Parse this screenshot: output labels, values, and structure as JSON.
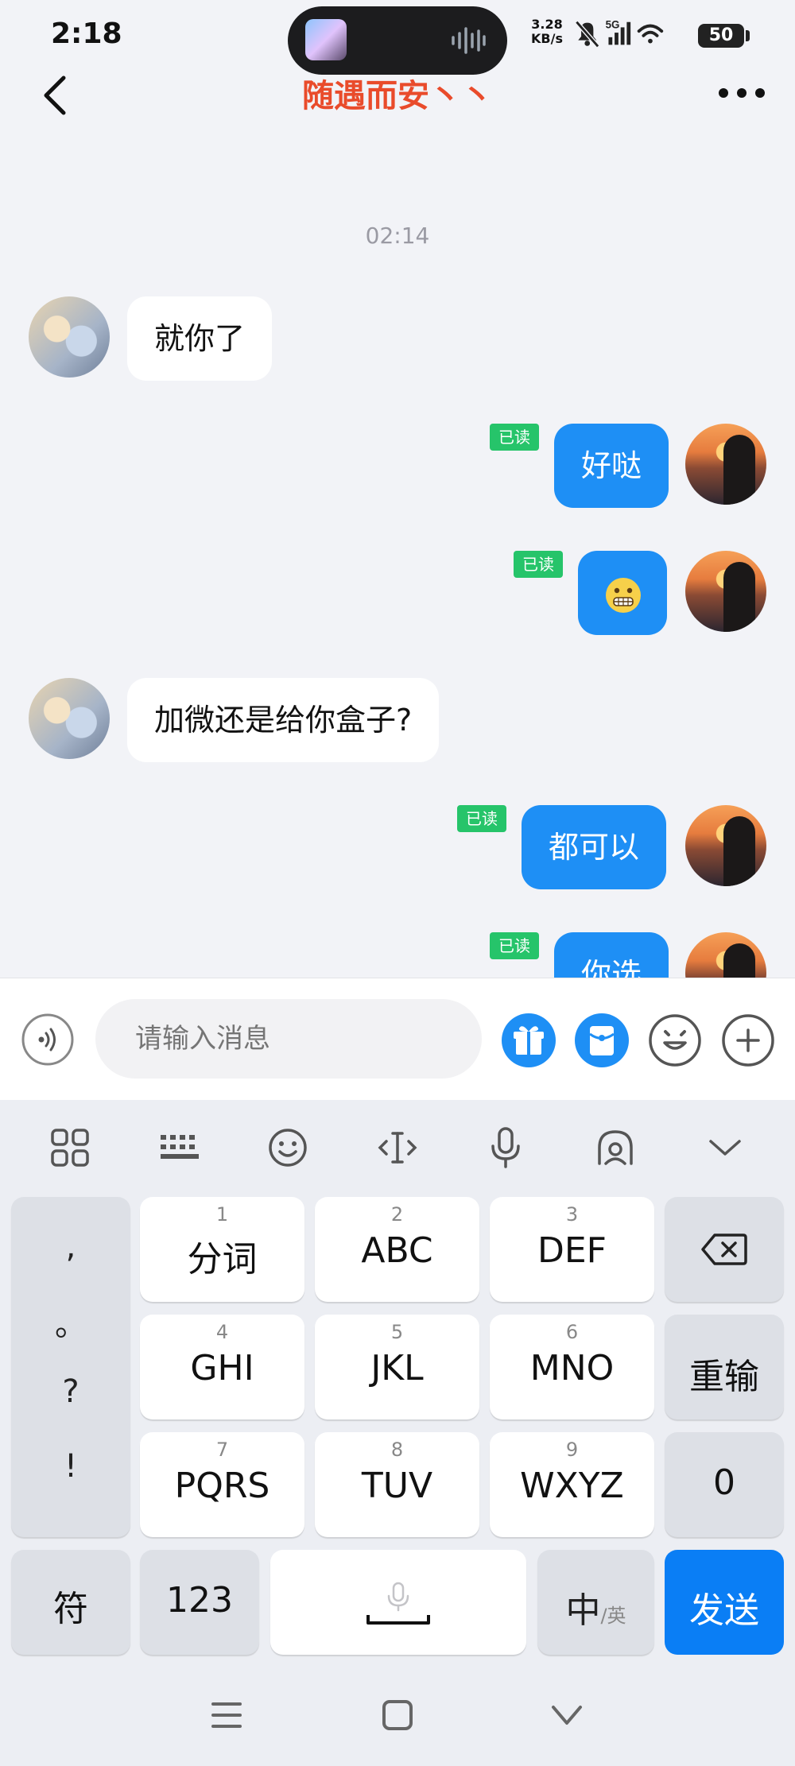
{
  "status_bar": {
    "time": "2:18",
    "speed_value": "3.28",
    "speed_unit": "KB/s",
    "network": "5G",
    "battery": "50"
  },
  "header": {
    "title": "随遇而安丶丶"
  },
  "messages": {
    "timestamp": "02:14",
    "items": [
      {
        "side": "in",
        "text": "就你了"
      },
      {
        "side": "out",
        "text": "好哒",
        "read": "已读"
      },
      {
        "side": "out",
        "emoji": "grimacing-face",
        "read": "已读"
      },
      {
        "side": "in",
        "text": "加微还是给你盒子?"
      },
      {
        "side": "out",
        "text": "都可以",
        "read": "已读"
      },
      {
        "side": "out",
        "text": "你选",
        "read": "已读"
      }
    ]
  },
  "input_bar": {
    "placeholder": "请输入消息",
    "icons": [
      "voice-icon",
      "gift-icon",
      "red-packet-icon",
      "emoji-icon",
      "plus-icon"
    ]
  },
  "keyboard": {
    "toolbar_icons": [
      "grid-icon",
      "keyboard-icon",
      "smiley-icon",
      "cursor-icon",
      "microphone-icon",
      "assistant-icon",
      "collapse-icon"
    ],
    "punctuation": [
      ",",
      "。",
      "?",
      "!"
    ],
    "keys": [
      {
        "num": "1",
        "label": "分词"
      },
      {
        "num": "2",
        "label": "ABC"
      },
      {
        "num": "3",
        "label": "DEF"
      },
      {
        "num": "4",
        "label": "GHI"
      },
      {
        "num": "5",
        "label": "JKL"
      },
      {
        "num": "6",
        "label": "MNO"
      },
      {
        "num": "7",
        "label": "PQRS"
      },
      {
        "num": "8",
        "label": "TUV"
      },
      {
        "num": "9",
        "label": "WXYZ"
      }
    ],
    "retype": "重输",
    "zero": "0",
    "symbols": "符",
    "numbers": "123",
    "lang_main": "中",
    "lang_sub": "/英",
    "send": "发送"
  },
  "colors": {
    "accent": "#1e8ff5",
    "title": "#e94b2b",
    "read_badge": "#26c46a",
    "send_key": "#0a7ef5"
  }
}
